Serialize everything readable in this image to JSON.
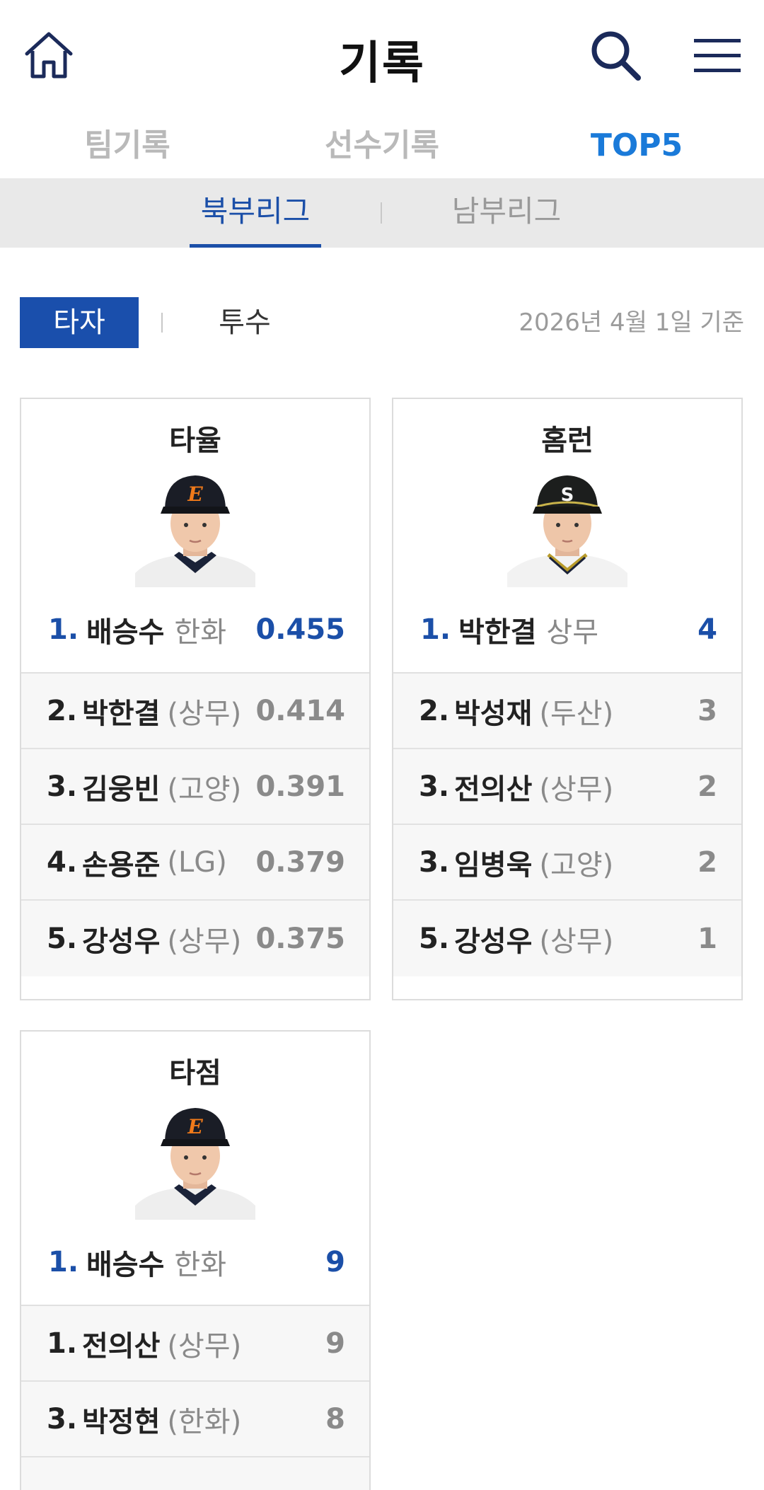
{
  "header": {
    "title": "기록",
    "home_icon": "home-icon",
    "search_icon": "search-icon",
    "menu_icon": "hamburger-menu-icon"
  },
  "main_tabs": [
    {
      "label": "팀기록",
      "active": false
    },
    {
      "label": "선수기록",
      "active": false
    },
    {
      "label": "TOP5",
      "active": true
    }
  ],
  "league_tabs": [
    {
      "label": "북부리그",
      "active": true
    },
    {
      "label": "남부리그",
      "active": false
    }
  ],
  "sub_tabs": [
    {
      "label": "타자",
      "active": true
    },
    {
      "label": "투수",
      "active": false
    }
  ],
  "as_of": "2026년 4월 1일 기준",
  "colors": {
    "accent_blue": "#1a7ad9",
    "navy": "#1b4fa8",
    "tab_bg": "#e9e9e9"
  },
  "cards": [
    {
      "title": "타율",
      "leader": {
        "rank": "1.",
        "name": "배승수",
        "team": "한화",
        "value": "0.455"
      },
      "rows": [
        {
          "rank": "2.",
          "name": "박한결",
          "team": "(상무)",
          "value": "0.414"
        },
        {
          "rank": "3.",
          "name": "김웅빈",
          "team": "(고양)",
          "value": "0.391"
        },
        {
          "rank": "4.",
          "name": "손용준",
          "team": "(LG)",
          "value": "0.379"
        },
        {
          "rank": "5.",
          "name": "강성우",
          "team": "(상무)",
          "value": "0.375"
        }
      ]
    },
    {
      "title": "홈런",
      "leader": {
        "rank": "1.",
        "name": "박한결",
        "team": "상무",
        "value": "4"
      },
      "rows": [
        {
          "rank": "2.",
          "name": "박성재",
          "team": "(두산)",
          "value": "3"
        },
        {
          "rank": "3.",
          "name": "전의산",
          "team": "(상무)",
          "value": "2"
        },
        {
          "rank": "3.",
          "name": "임병욱",
          "team": "(고양)",
          "value": "2"
        },
        {
          "rank": "5.",
          "name": "강성우",
          "team": "(상무)",
          "value": "1"
        }
      ]
    },
    {
      "title": "타점",
      "leader": {
        "rank": "1.",
        "name": "배승수",
        "team": "한화",
        "value": "9"
      },
      "rows": [
        {
          "rank": "1.",
          "name": "전의산",
          "team": "(상무)",
          "value": "9"
        },
        {
          "rank": "3.",
          "name": "박정현",
          "team": "(한화)",
          "value": "8"
        }
      ]
    }
  ]
}
